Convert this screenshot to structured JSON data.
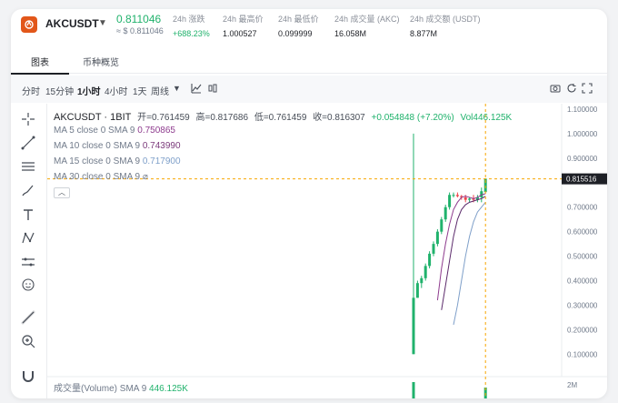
{
  "header": {
    "pair": "AKCUSDT",
    "price": "0.811046",
    "price_usd": "≈ $ 0.811046",
    "stats": [
      {
        "label": "24h 涨跌",
        "value": "+688.23%",
        "green": true
      },
      {
        "label": "24h 最高价",
        "value": "1.000527",
        "green": false
      },
      {
        "label": "24h 最低价",
        "value": "0.099999",
        "green": false
      },
      {
        "label": "24h 成交量 (AKC)",
        "value": "16.058M",
        "green": false
      },
      {
        "label": "24h 成交额 (USDT)",
        "value": "8.877M",
        "green": false
      }
    ]
  },
  "tabs": [
    "图表",
    "币种概览"
  ],
  "toolbar": {
    "timeframes": [
      "分时",
      "15分钟",
      "1小时",
      "4小时",
      "1天",
      "周线"
    ],
    "active_timeframe": "1小时"
  },
  "legend": {
    "symbol": "AKCUSDT · 1BIT",
    "open": "开=0.761459",
    "high": "高=0.817686",
    "low": "低=0.761459",
    "close": "收=0.816307",
    "change": "+0.054848 (+7.20%)",
    "volume": "Vol446.125K"
  },
  "ma": [
    {
      "label": "MA 5 close 0 SMA 9",
      "value": "0.750865",
      "color": "#8e3b8e"
    },
    {
      "label": "MA 10 close 0 SMA 9",
      "value": "0.743990",
      "color": "#7b3a7b"
    },
    {
      "label": "MA 15 close 0 SMA 9",
      "value": "0.717900",
      "color": "#7e9fc9"
    },
    {
      "label": "MA 30 close 0 SMA 9",
      "value": "",
      "color": "#707a8a"
    }
  ],
  "volume_legend": {
    "label": "成交量(Volume) SMA 9",
    "value": "446.125K"
  },
  "chart_data": {
    "type": "candlestick",
    "y_ticks": [
      "1.100000",
      "1.000000",
      "0.900000",
      "0.700000",
      "0.600000",
      "0.500000",
      "0.400000",
      "0.300000",
      "0.200000",
      "0.100000"
    ],
    "y_range": [
      0.09,
      1.1
    ],
    "current_price_label": "0.815516",
    "current_price": 0.815516,
    "volume_tick": "2M",
    "candles": [
      {
        "o": 0.1,
        "h": 1.0,
        "l": 0.1,
        "c": 0.33
      },
      {
        "o": 0.33,
        "h": 0.4,
        "l": 0.33,
        "c": 0.39
      },
      {
        "o": 0.39,
        "h": 0.42,
        "l": 0.37,
        "c": 0.41
      },
      {
        "o": 0.41,
        "h": 0.47,
        "l": 0.4,
        "c": 0.46
      },
      {
        "o": 0.46,
        "h": 0.52,
        "l": 0.45,
        "c": 0.51
      },
      {
        "o": 0.51,
        "h": 0.56,
        "l": 0.5,
        "c": 0.55
      },
      {
        "o": 0.55,
        "h": 0.61,
        "l": 0.54,
        "c": 0.6
      },
      {
        "o": 0.6,
        "h": 0.66,
        "l": 0.59,
        "c": 0.65
      },
      {
        "o": 0.65,
        "h": 0.71,
        "l": 0.64,
        "c": 0.7
      },
      {
        "o": 0.7,
        "h": 0.76,
        "l": 0.69,
        "c": 0.75
      },
      {
        "o": 0.75,
        "h": 0.76,
        "l": 0.74,
        "c": 0.75
      },
      {
        "o": 0.75,
        "h": 0.76,
        "l": 0.74,
        "c": 0.745
      },
      {
        "o": 0.745,
        "h": 0.75,
        "l": 0.73,
        "c": 0.74
      },
      {
        "o": 0.74,
        "h": 0.75,
        "l": 0.72,
        "c": 0.73
      },
      {
        "o": 0.73,
        "h": 0.74,
        "l": 0.72,
        "c": 0.735
      },
      {
        "o": 0.735,
        "h": 0.75,
        "l": 0.72,
        "c": 0.73
      },
      {
        "o": 0.73,
        "h": 0.75,
        "l": 0.72,
        "c": 0.74
      },
      {
        "o": 0.74,
        "h": 0.78,
        "l": 0.72,
        "c": 0.765
      },
      {
        "o": 0.761459,
        "h": 0.817686,
        "l": 0.761459,
        "c": 0.816307
      }
    ],
    "ma5": [
      0.32,
      0.45,
      0.55,
      0.63,
      0.69,
      0.72,
      0.74,
      0.745,
      0.74,
      0.735,
      0.74,
      0.75,
      0.755
    ],
    "ma10": [
      0.28,
      0.38,
      0.48,
      0.58,
      0.65,
      0.69,
      0.71,
      0.72,
      0.725,
      0.73,
      0.735,
      0.744
    ],
    "ma15": [
      0.22,
      0.3,
      0.4,
      0.5,
      0.58,
      0.64,
      0.68,
      0.7,
      0.72
    ]
  },
  "colors": {
    "up": "#20b26c",
    "down": "#ef454a",
    "accent": "#f7a600"
  }
}
